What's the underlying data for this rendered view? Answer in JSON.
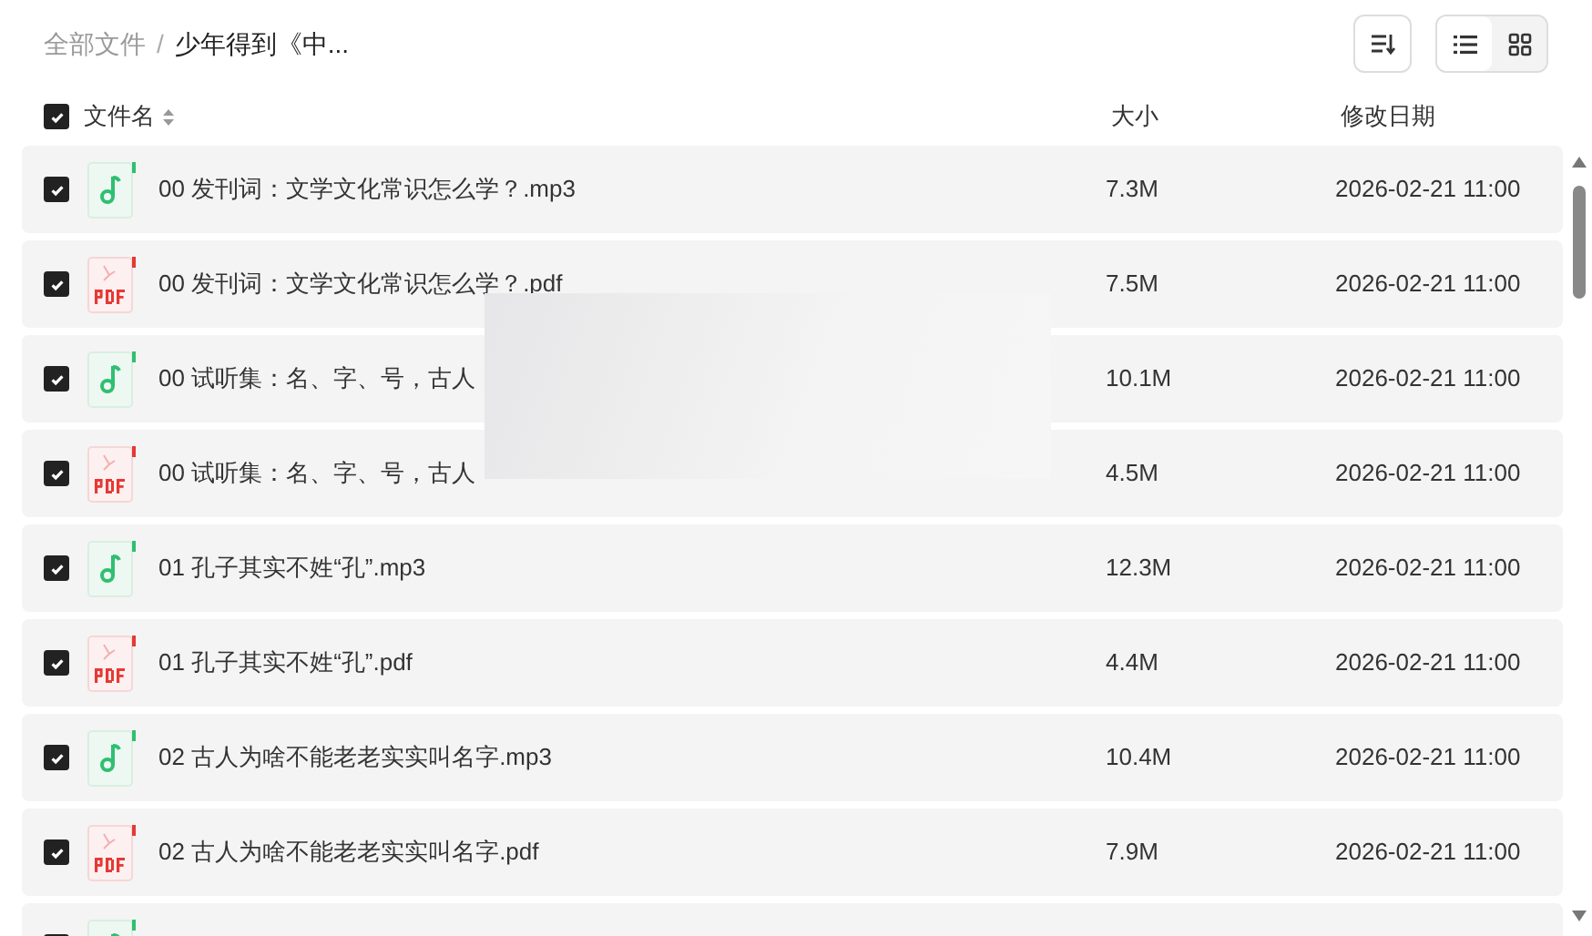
{
  "breadcrumb": {
    "separator": "/",
    "items": [
      {
        "label": "全部文件",
        "current": false
      },
      {
        "label": "少年得到《中...",
        "current": true
      }
    ]
  },
  "toolbar": {
    "view_modes": [
      {
        "kind": "list",
        "selected": true
      },
      {
        "kind": "grid",
        "selected": false
      }
    ]
  },
  "table": {
    "select_all": {
      "checked": true
    },
    "columns": [
      "文件名",
      "大小",
      "修改日期"
    ],
    "rows": [
      {
        "kind": "mp3",
        "checked": true,
        "name": "00 发刊词：文学文化常识怎么学？.mp3",
        "size": "7.3M",
        "date": "2026-02-21 11:00"
      },
      {
        "kind": "pdf",
        "checked": true,
        "name": "00 发刊词：文学文化常识怎么学？.pdf",
        "size": "7.5M",
        "date": "2026-02-21 11:00"
      },
      {
        "kind": "mp3",
        "checked": true,
        "name": "00 试听集：名、字、号，古人",
        "size": "10.1M",
        "date": "2026-02-21 11:00"
      },
      {
        "kind": "pdf",
        "checked": true,
        "name": "00 试听集：名、字、号，古人",
        "size": "4.5M",
        "date": "2026-02-21 11:00"
      },
      {
        "kind": "mp3",
        "checked": true,
        "name": "01 孔子其实不姓“孔”.mp3",
        "size": "12.3M",
        "date": "2026-02-21 11:00"
      },
      {
        "kind": "pdf",
        "checked": true,
        "name": "01 孔子其实不姓“孔”.pdf",
        "size": "4.4M",
        "date": "2026-02-21 11:00"
      },
      {
        "kind": "mp3",
        "checked": true,
        "name": "02 古人为啥不能老老实实叫名字.mp3",
        "size": "10.4M",
        "date": "2026-02-21 11:00"
      },
      {
        "kind": "pdf",
        "checked": true,
        "name": "02 古人为啥不能老老实实叫名字.pdf",
        "size": "7.9M",
        "date": "2026-02-21 11:00"
      },
      {
        "kind": "mp3",
        "checked": true
      }
    ]
  }
}
